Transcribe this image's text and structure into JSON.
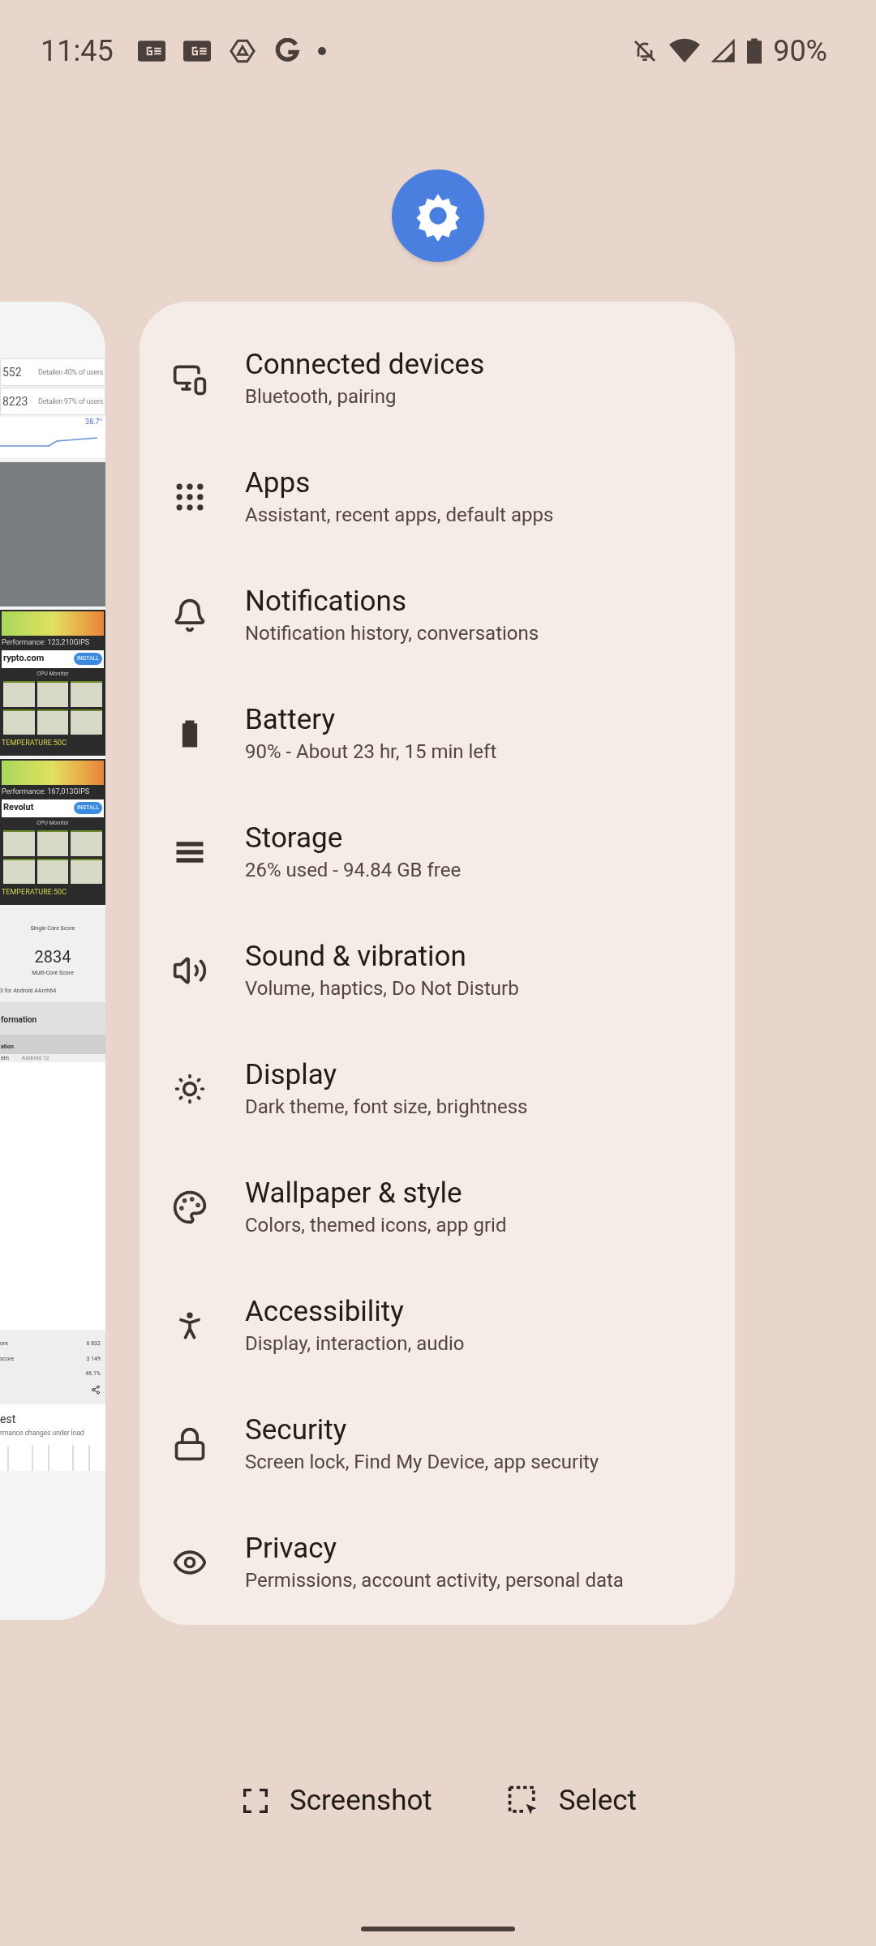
{
  "status_bar": {
    "time": "11:45",
    "battery_text": "90%"
  },
  "left_card": {
    "top_rows": [
      {
        "value": "552",
        "note": "Detailen 40% of users"
      },
      {
        "value": "8223",
        "note": "Detailen 97% of users"
      }
    ],
    "graph_label": "38.7°",
    "panels": [
      {
        "performance": "Performance: 123,210GIPS",
        "ad": "rypto.com",
        "install": "INSTALL",
        "monitor": "CPU Monitor",
        "footer": "TEMPERATURE:50C"
      },
      {
        "performance": "Performance: 167,013GIPS",
        "ad": "Revolut",
        "install": "INSTALL",
        "monitor": "CPU Monitor",
        "footer": "TEMPERATURE:50C"
      }
    ],
    "single_label": "Single Core Score",
    "multi_score": "2834",
    "multi_label": "Multi-Core Score",
    "version": "3 for Android AArch64",
    "info_heading": "formation",
    "info_sub": "ation",
    "info_key": "em",
    "info_value": "Android 12",
    "stats": [
      {
        "label": "ore",
        "value": "6 832"
      },
      {
        "label": "score",
        "value": "3 149"
      },
      {
        "value": "46.1%"
      }
    ],
    "test_title": "est",
    "test_sub": "rmance changes under load"
  },
  "settings": [
    {
      "kind": "devices",
      "title": "Connected devices",
      "subtitle": "Bluetooth, pairing"
    },
    {
      "kind": "apps",
      "title": "Apps",
      "subtitle": "Assistant, recent apps, default apps"
    },
    {
      "kind": "notifications",
      "title": "Notifications",
      "subtitle": "Notification history, conversations"
    },
    {
      "kind": "battery",
      "title": "Battery",
      "subtitle": "90% - About 23 hr, 15 min left"
    },
    {
      "kind": "storage",
      "title": "Storage",
      "subtitle": "26% used - 94.84 GB free"
    },
    {
      "kind": "sound",
      "title": "Sound & vibration",
      "subtitle": "Volume, haptics, Do Not Disturb"
    },
    {
      "kind": "display",
      "title": "Display",
      "subtitle": "Dark theme, font size, brightness"
    },
    {
      "kind": "wallpaper",
      "title": "Wallpaper & style",
      "subtitle": "Colors, themed icons, app grid"
    },
    {
      "kind": "accessibility",
      "title": "Accessibility",
      "subtitle": "Display, interaction, audio"
    },
    {
      "kind": "security",
      "title": "Security",
      "subtitle": "Screen lock, Find My Device, app security"
    },
    {
      "kind": "privacy",
      "title": "Privacy",
      "subtitle": "Permissions, account activity, personal data"
    }
  ],
  "actions": [
    {
      "kind": "screenshot",
      "label": "Screenshot"
    },
    {
      "kind": "select",
      "label": "Select"
    }
  ]
}
